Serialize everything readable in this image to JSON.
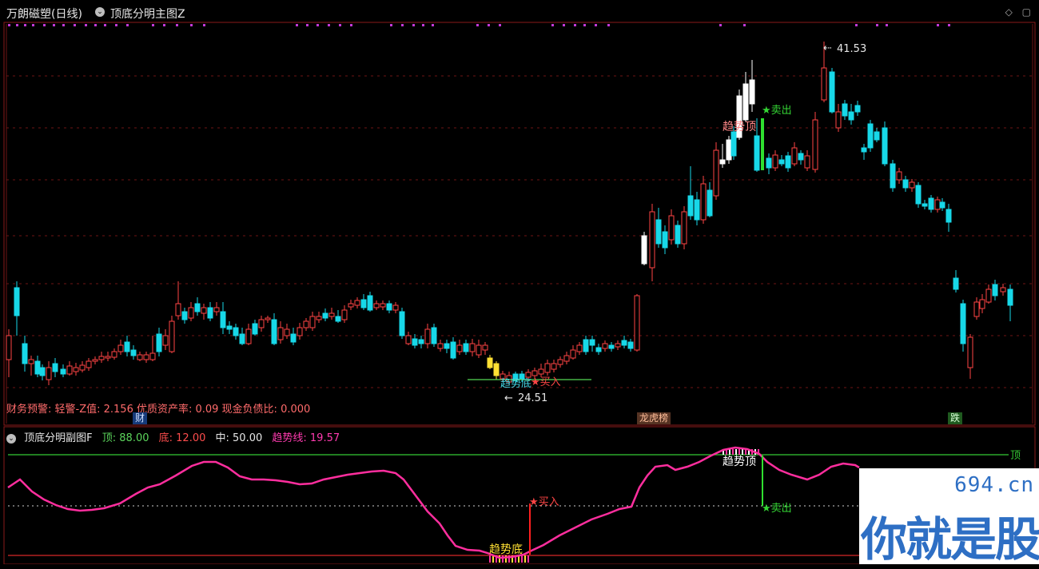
{
  "header": {
    "title": "万朗磁塑(日线)",
    "indicator": "顶底分明主图Z",
    "toggle_symbol": "⌄",
    "icons": [
      "◇",
      "▢"
    ]
  },
  "main_chart": {
    "price_high_label": "41.53",
    "price_low_label": "24.51",
    "arrow_high": "⇠",
    "arrow_low": "←",
    "labels": {
      "trend_top": "趋势顶",
      "trend_bottom": "趋势底",
      "sell": "★卖出",
      "buy": "★买入"
    },
    "info_line": "财务预警: 轻警-Z值: 2.156 优质资产率: 0.09 现金负债比: 0.000",
    "badges": {
      "cai": "财",
      "long": "龙虎榜",
      "die": "跌"
    }
  },
  "sub_chart": {
    "title": "顶底分明副图F",
    "top_label": "顶: 88.00",
    "bottom_label": "底: 12.00",
    "mid_label": "中: 50.00",
    "trend_label": "趋势线: 19.57",
    "right_label": "顶",
    "trend_top": "趋势顶",
    "trend_bottom": "趋势底",
    "sell": "★卖出",
    "buy": "★买入"
  },
  "watermark": {
    "site": "694.cn",
    "text": "你就是股神"
  },
  "colors": {
    "up": "#ff4545",
    "down": "#17d8e8",
    "white": "#ffffff",
    "trend_line": "#ff2e9e",
    "top_line": "#34c934",
    "bottom_line": "#d62828",
    "dots": "#c43ad8"
  },
  "chart_data": {
    "type": "candlestick",
    "price_high": 41.53,
    "price_low": 24.51,
    "oscillator": {
      "top": 88.0,
      "bottom": 12.0,
      "mid": 50.0,
      "trend": 19.57
    }
  }
}
